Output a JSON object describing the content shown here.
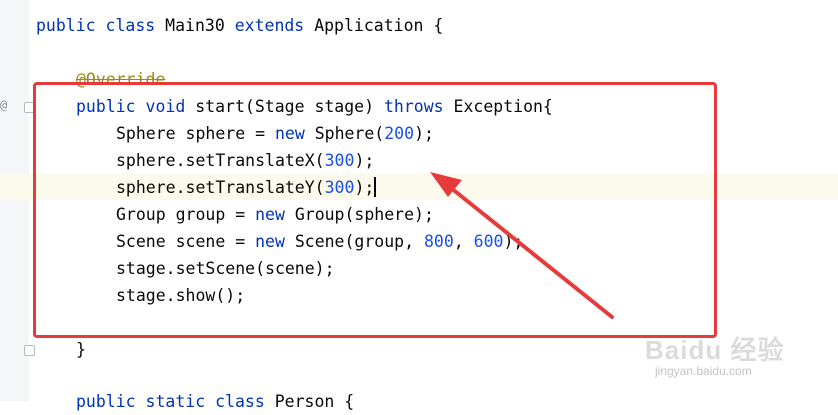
{
  "editor": {
    "lines": {
      "class_decl": {
        "kw_public": "public",
        "kw_class": "class",
        "name": "Main30",
        "kw_extends": "extends",
        "parent": "Application {"
      },
      "annotation": "@Override",
      "method_sig": {
        "kw_public": "public",
        "kw_void": "void",
        "rest": "start(Stage stage)",
        "kw_throws": "throws",
        "exc": "Exception{"
      },
      "sphere_decl": {
        "a": "Sphere sphere = ",
        "kw_new": "new",
        "b": " Sphere(",
        "num": "200",
        "c": ");"
      },
      "translate_x": {
        "a": "sphere.setTranslateX(",
        "num": "300",
        "c": ");"
      },
      "translate_y": {
        "a": "sphere.setTranslateY(",
        "num": "300",
        "c": ");"
      },
      "group_decl": {
        "a": "Group group = ",
        "kw_new": "new",
        "b": " Group(sphere);"
      },
      "scene_decl": {
        "a": "Scene scene = ",
        "kw_new": "new",
        "b": " Scene(group, ",
        "num1": "800",
        "sep": ", ",
        "num2": "600",
        "c": ");"
      },
      "set_scene": "stage.setScene(scene);",
      "show": "stage.show();",
      "close_brace": "}",
      "next_decl": {
        "kw_public": "public",
        "kw_static": "static",
        "kw_class": "class",
        "name": "Person {"
      }
    }
  },
  "gutter": {
    "override_marker": "@"
  },
  "watermark": {
    "logo": "Baidu 经验",
    "url": "jingyan.baidu.com"
  },
  "colors": {
    "highlight": "#e53b3b",
    "keyword": "#0033b3",
    "number": "#1750eb",
    "annotation": "#9e880d"
  }
}
